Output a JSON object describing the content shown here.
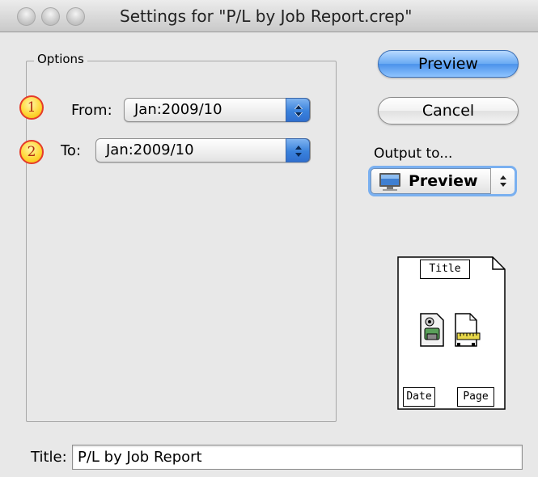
{
  "window": {
    "title": "Settings for \"P/L by Job Report.crep\""
  },
  "options": {
    "group_label": "Options",
    "from": {
      "badge": "1",
      "label": "From:",
      "value": "Jan:2009/10"
    },
    "to": {
      "badge": "2",
      "label": "To:",
      "value": "Jan:2009/10"
    }
  },
  "buttons": {
    "preview_label": "Preview",
    "cancel_label": "Cancel"
  },
  "output": {
    "label": "Output to...",
    "selected": "Preview",
    "icon": "monitor-icon"
  },
  "page_preview": {
    "header": "Title",
    "footer_left": "Date",
    "footer_right": "Page"
  },
  "title_field": {
    "label": "Title:",
    "value": "P/L by Job Report"
  },
  "colors": {
    "default_button": "#69a9f3",
    "popup_arrows": "#3a82dc",
    "badge_fill": "#ffd83a",
    "badge_border": "#e53b2a"
  }
}
